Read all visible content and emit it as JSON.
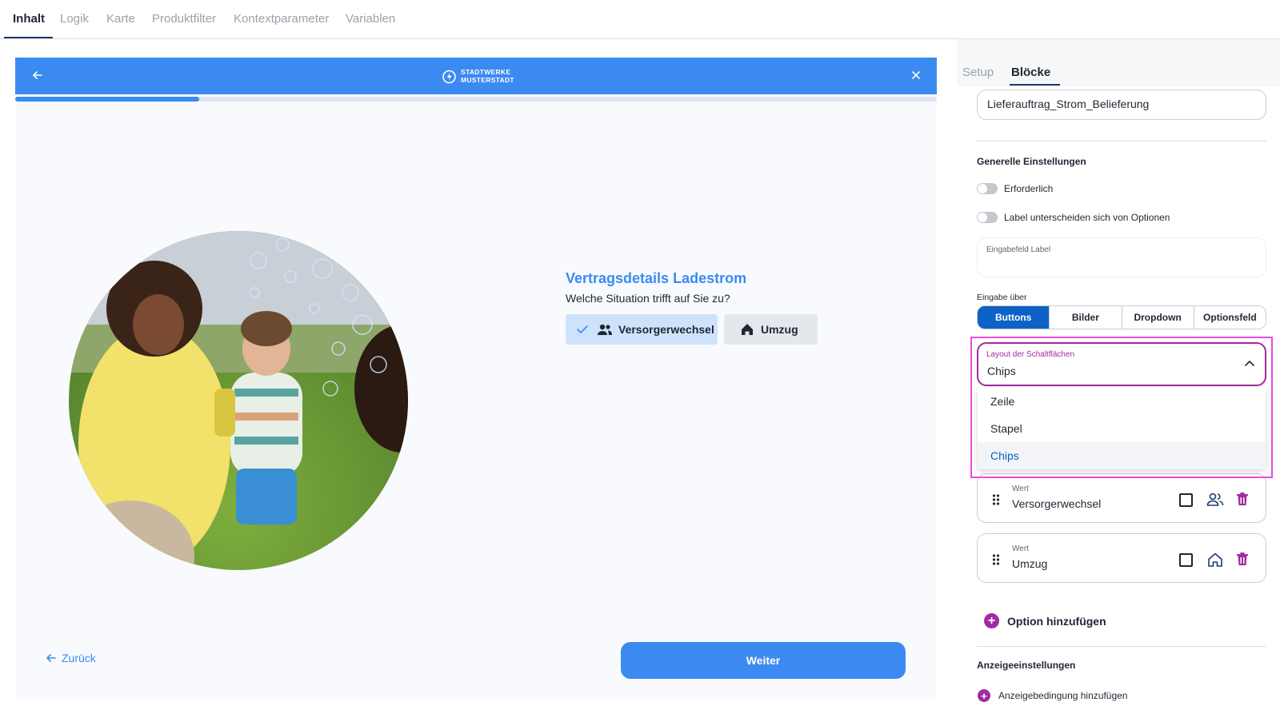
{
  "top_tabs": [
    {
      "label": "Inhalt",
      "active": true
    },
    {
      "label": "Logik"
    },
    {
      "label": "Karte"
    },
    {
      "label": "Produktfilter"
    },
    {
      "label": "Kontextparameter"
    },
    {
      "label": "Variablen"
    }
  ],
  "preview": {
    "logo": {
      "line1": "STADTWERKE",
      "line2": "MUSTERSTADT"
    },
    "progress_fraction": 0.2,
    "question_title": "Vertragsdetails Ladestrom",
    "question_subtitle": "Welche Situation trifft auf Sie zu?",
    "chips": [
      {
        "label": "Versorgerwechsel",
        "selected": true,
        "icon": "users-icon"
      },
      {
        "label": "Umzug",
        "selected": false,
        "icon": "home-icon"
      }
    ],
    "back_label": "Zurück",
    "next_label": "Weiter"
  },
  "panel": {
    "tabs": [
      {
        "label": "Setup"
      },
      {
        "label": "Blöcke",
        "active": true
      }
    ],
    "block_name": "Lieferauftrag_Strom_Belieferung",
    "general_title": "Generelle Einstellungen",
    "toggles": [
      {
        "label": "Erforderlich",
        "on": false
      },
      {
        "label": "Label unterscheiden sich von Optionen",
        "on": false
      }
    ],
    "input_label_placeholder": "Eingabefeld Label",
    "input_via_label": "Eingabe über",
    "input_via_options": [
      "Buttons",
      "Bilder",
      "Dropdown",
      "Optionsfeld"
    ],
    "input_via_selected": "Buttons",
    "layout_select": {
      "label": "Layout der Schaltflächen",
      "value": "Chips",
      "options": [
        "Zeile",
        "Stapel",
        "Chips"
      ]
    },
    "option_cards": [
      {
        "value_label": "Wert",
        "value": "Versorgerwechsel",
        "icon": "users-icon"
      },
      {
        "value_label": "Wert",
        "value": "Umzug",
        "icon": "home-icon"
      }
    ],
    "add_option_label": "Option hinzufügen",
    "display_title": "Anzeigeeinstellungen",
    "add_condition_label": "Anzeigebedingung hinzufügen"
  },
  "colors": {
    "primary": "#3b8af2",
    "accent_purple": "#a32aa0",
    "highlight_pink": "#e94be3",
    "segment_active": "#0c62c7"
  }
}
